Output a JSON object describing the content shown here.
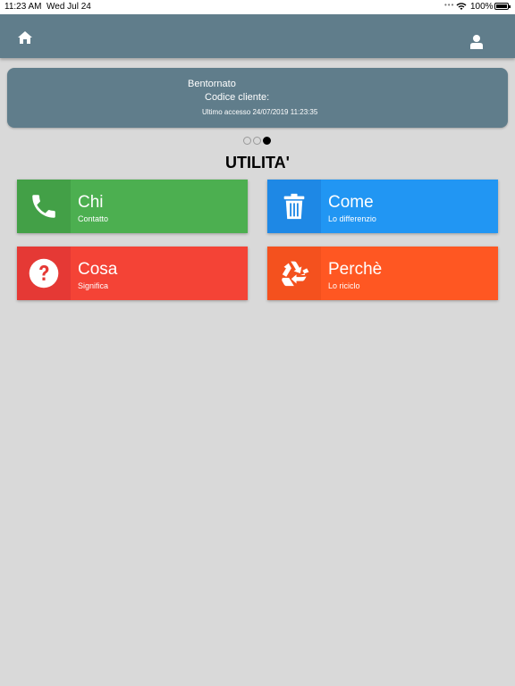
{
  "status_bar": {
    "time": "11:23 AM",
    "date": "Wed Jul 24",
    "battery": "100%",
    "icons": [
      "wifi-icon",
      "battery-icon"
    ]
  },
  "nav": {
    "icons": [
      "home-icon",
      "user-icon"
    ]
  },
  "welcome": {
    "greeting": "Bentornato",
    "customer_code_label": "Codice cliente:",
    "last_access": "Ultimo accesso 24/07/2019 11:23:35"
  },
  "pager": {
    "count": 3,
    "active_index": 2
  },
  "section_title": "UTILITA'",
  "tiles": [
    {
      "title": "Chi",
      "subtitle": "Contatto",
      "icon": "phone-icon",
      "color": "#4caf50",
      "icon_bg": "#43a047"
    },
    {
      "title": "Come",
      "subtitle": "Lo differenzio",
      "icon": "trash-icon",
      "color": "#2196f3",
      "icon_bg": "#1e88e5"
    },
    {
      "title": "Cosa",
      "subtitle": "Significa",
      "icon": "question-icon",
      "color": "#f44336",
      "icon_bg": "#e53935"
    },
    {
      "title": "Perchè",
      "subtitle": "Lo riciclo",
      "icon": "recycle-icon",
      "color": "#ff5722",
      "icon_bg": "#f4511e"
    }
  ]
}
